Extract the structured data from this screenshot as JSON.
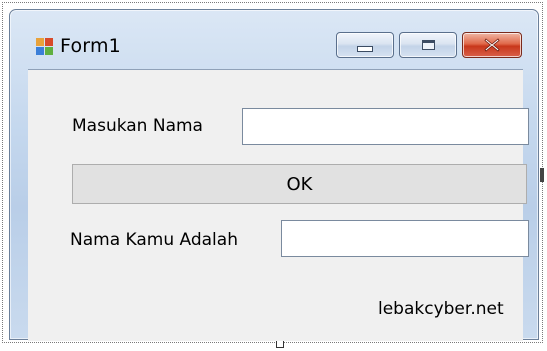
{
  "window": {
    "title": "Form1",
    "icon": "winforms-app-icon",
    "controls": {
      "minimize_icon": "minimize-icon",
      "maximize_icon": "maximize-icon",
      "close_icon": "close-icon"
    }
  },
  "form": {
    "name_label": "Masukan Nama",
    "name_input_value": "",
    "ok_button_label": "OK",
    "result_label": "Nama Kamu Adalah",
    "result_input_value": "",
    "footer_text": "lebakcyber.net"
  },
  "colors": {
    "close_button": "#c8371b",
    "titlebar": "#c5d8ee",
    "client_background": "#f0f0f0",
    "button_background": "#e1e1e1"
  }
}
